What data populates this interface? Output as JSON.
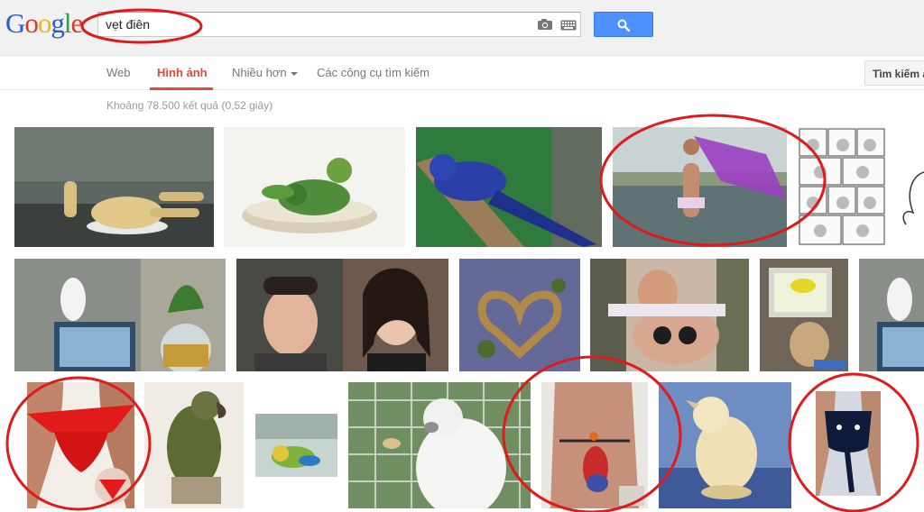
{
  "logo": {
    "letters": [
      "G",
      "o",
      "o",
      "g",
      "l",
      "e"
    ],
    "colors": [
      "#2a5bd7",
      "#d9372a",
      "#f2b50f",
      "#2a5bd7",
      "#2f9e44",
      "#d9372a"
    ]
  },
  "search": {
    "query": "vẹt điên",
    "camera_icon": "camera-icon",
    "keyboard_icon": "keyboard-icon",
    "button_icon": "magnifier-icon"
  },
  "nav": {
    "items": [
      "Web",
      "Hình ảnh",
      "Nhiều hơn",
      "Các công cụ tìm kiếm"
    ],
    "active": "Hình ảnh",
    "right_button": "Tìm kiếm a"
  },
  "results": {
    "stats": "Khoảng 78.500 kết quả (0,52 giây)"
  },
  "annotations": {
    "color": "#e01a1a",
    "circled_count": 6
  },
  "colors": {
    "accent": "#dd4b39",
    "button": "#4d90fe"
  }
}
